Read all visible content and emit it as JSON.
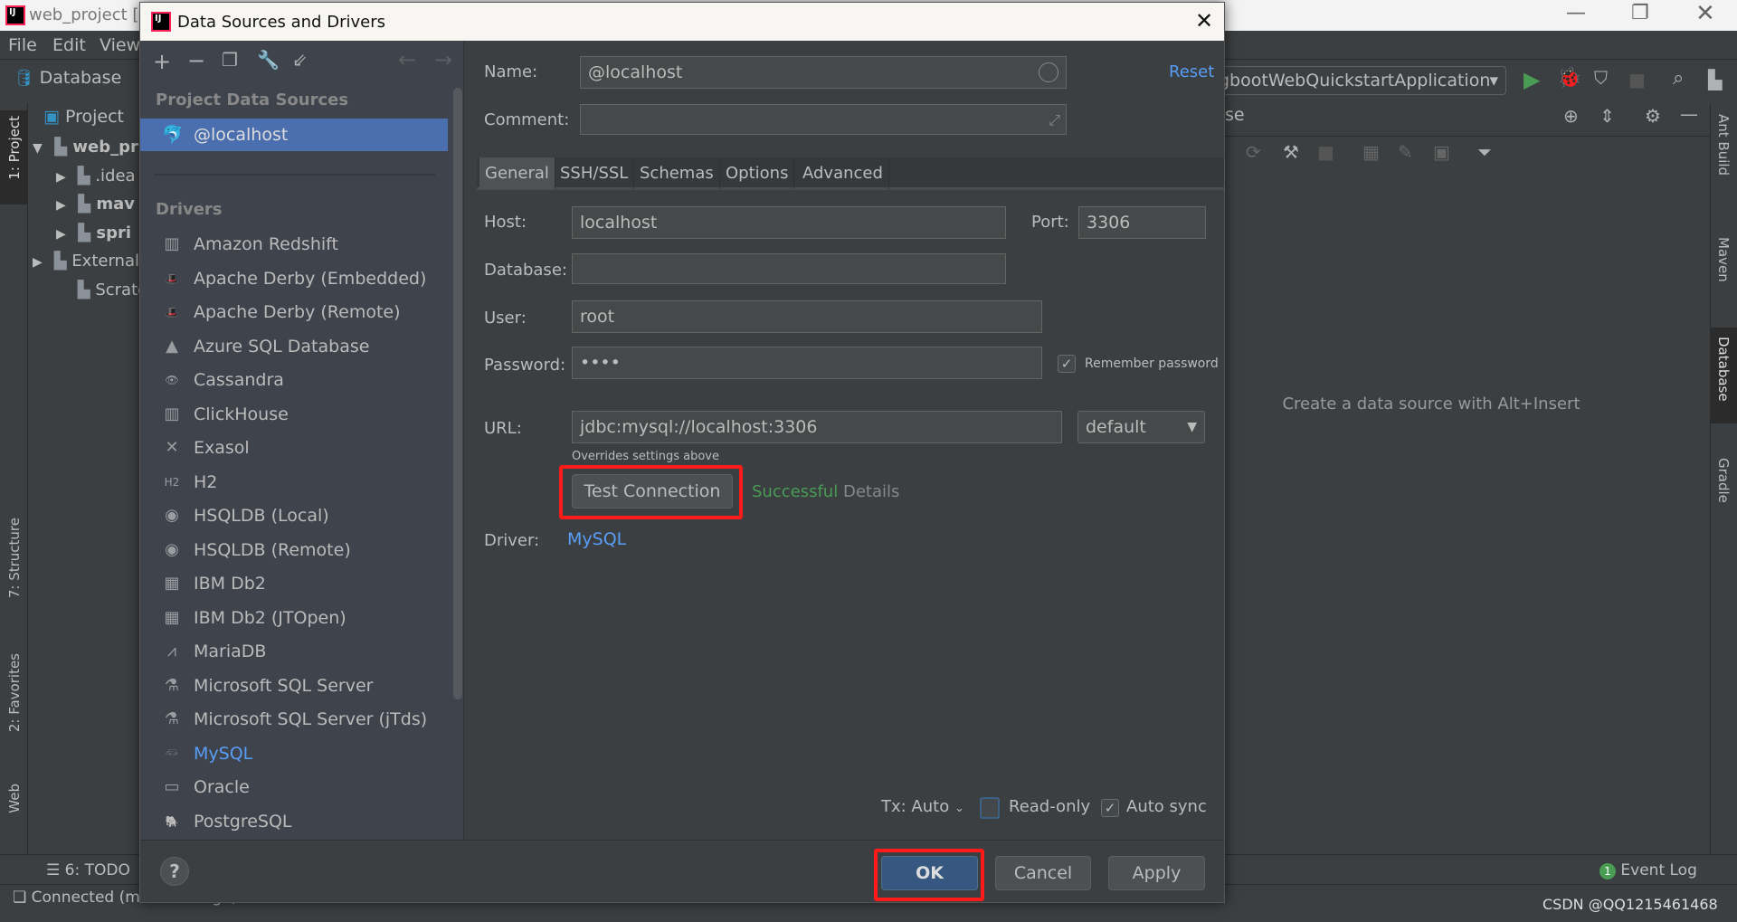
{
  "ide": {
    "title": "web_project [D:",
    "menu": [
      "File",
      "Edit",
      "View"
    ],
    "panel_title": "Database",
    "project_header": "Project",
    "tree": [
      {
        "label": "web_pr",
        "icon": "module-folder-icon",
        "arrow": "▼",
        "indent": 0,
        "bold": true
      },
      {
        "label": ".idea",
        "icon": "folder-icon",
        "arrow": "▶",
        "indent": 1
      },
      {
        "label": "mav",
        "icon": "module-folder-icon",
        "arrow": "▶",
        "indent": 1,
        "bold": true
      },
      {
        "label": "spri",
        "icon": "module-folder-icon",
        "arrow": "▶",
        "indent": 1,
        "bold": true
      },
      {
        "label": "External",
        "icon": "library-icon",
        "arrow": "▶",
        "indent": 0
      },
      {
        "label": "Scratch",
        "icon": "scratch-icon",
        "arrow": "",
        "indent": 1
      }
    ],
    "left_tools": [
      "1: Project",
      "7: Structure",
      "2: Favorites",
      "Web"
    ],
    "right_tools": [
      "Ant Build",
      "Maven",
      "Database",
      "Gradle"
    ],
    "run_config": "gbootWebQuickstartApplication",
    "db_panel_partial": "se",
    "empty_hint": "Create a data source with Alt+Insert",
    "todo": "6: TODO",
    "event_log": "Event Log",
    "event_count": "1",
    "status": "Connected (moments ago)",
    "watermark": "CSDN @QQ1215461468",
    "colors": {
      "run": "#499c54",
      "selection": "#4b6eaf",
      "link": "#589df6",
      "success": "#499c54",
      "highlight": "#ff1a1a"
    }
  },
  "dialog": {
    "title": "Data Sources and Drivers",
    "left": {
      "section_sources": "Project Data Sources",
      "sources": [
        {
          "label": "@localhost",
          "icon": "mysql-dolphin-icon",
          "selected": true
        }
      ],
      "section_drivers": "Drivers",
      "drivers": [
        {
          "label": "Amazon Redshift",
          "icon": "▥"
        },
        {
          "label": "Apache Derby (Embedded)",
          "icon": "🎩"
        },
        {
          "label": "Apache Derby (Remote)",
          "icon": "🎩"
        },
        {
          "label": "Azure SQL Database",
          "icon": "▲"
        },
        {
          "label": "Cassandra",
          "icon": "👁"
        },
        {
          "label": "ClickHouse",
          "icon": "▥"
        },
        {
          "label": "Exasol",
          "icon": "✕"
        },
        {
          "label": "H2",
          "icon": "H2"
        },
        {
          "label": "HSQLDB (Local)",
          "icon": "◉"
        },
        {
          "label": "HSQLDB (Remote)",
          "icon": "◉"
        },
        {
          "label": "IBM Db2",
          "icon": "▦"
        },
        {
          "label": "IBM Db2 (JTOpen)",
          "icon": "▦"
        },
        {
          "label": "MariaDB",
          "icon": "⩘"
        },
        {
          "label": "Microsoft SQL Server",
          "icon": "⚗"
        },
        {
          "label": "Microsoft SQL Server (jTds)",
          "icon": "⚗"
        },
        {
          "label": "MySQL",
          "icon": "𓆛",
          "highlight": true
        },
        {
          "label": "Oracle",
          "icon": "▭"
        },
        {
          "label": "PostgreSQL",
          "icon": "🐘"
        }
      ]
    },
    "form": {
      "name_label": "Name:",
      "name_value": "@localhost",
      "reset": "Reset",
      "comment_label": "Comment:",
      "comment_value": "",
      "tabs": [
        "General",
        "SSH/SSL",
        "Schemas",
        "Options",
        "Advanced"
      ],
      "active_tab": "General",
      "host_label": "Host:",
      "host_value": "localhost",
      "port_label": "Port:",
      "port_value": "3306",
      "database_label": "Database:",
      "database_value": "",
      "user_label": "User:",
      "user_value": "root",
      "password_label": "Password:",
      "password_value": "••••",
      "remember_password": "Remember password",
      "remember_checked": true,
      "url_label": "URL:",
      "url_value": "jdbc:mysql://localhost:3306",
      "url_mode": "default",
      "url_hint": "Overrides settings above",
      "test_connection": "Test Connection",
      "test_status": "Successful",
      "details": "Details",
      "driver_label": "Driver:",
      "driver_value": "MySQL",
      "tx": "Tx: Auto",
      "read_only": "Read-only",
      "read_only_checked": false,
      "auto_sync": "Auto sync",
      "auto_sync_checked": true
    },
    "buttons": {
      "ok": "OK",
      "cancel": "Cancel",
      "apply": "Apply",
      "help": "?"
    }
  }
}
